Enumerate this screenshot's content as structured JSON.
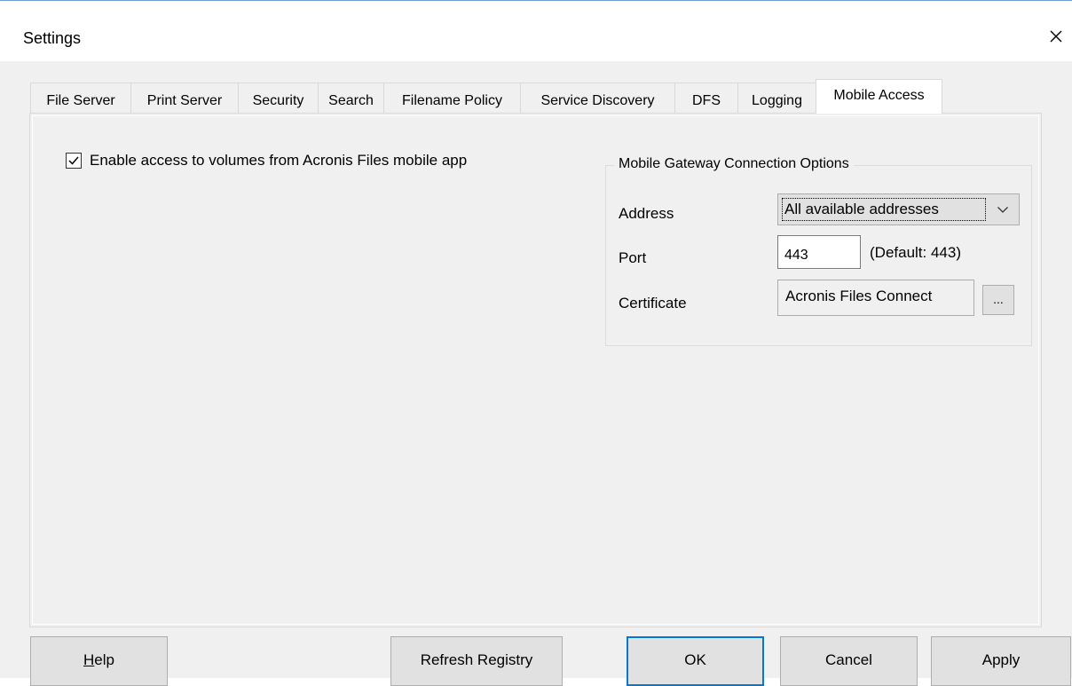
{
  "window": {
    "title": "Settings",
    "close_icon": "close-icon",
    "accent_color": "#0078d7"
  },
  "tabs": [
    {
      "label": "File Server",
      "active": false
    },
    {
      "label": "Print Server",
      "active": false
    },
    {
      "label": "Security",
      "active": false
    },
    {
      "label": "Search",
      "active": false
    },
    {
      "label": "Filename Policy",
      "active": false
    },
    {
      "label": "Service Discovery",
      "active": false
    },
    {
      "label": "DFS",
      "active": false
    },
    {
      "label": "Logging",
      "active": false
    },
    {
      "label": "Mobile Access",
      "active": true
    }
  ],
  "mobile_access": {
    "enable_checkbox": {
      "label": "Enable access to volumes from Acronis Files mobile app",
      "checked": true
    },
    "gateway_group": {
      "title": "Mobile Gateway Connection Options",
      "address_label": "Address",
      "address_value": "All available addresses",
      "port_label": "Port",
      "port_value": "443",
      "port_default": "(Default: 443)",
      "certificate_label": "Certificate",
      "certificate_value": "Acronis Files Connect",
      "certificate_browse": "..."
    }
  },
  "buttons": {
    "help_mnemonic": "H",
    "help_rest": "elp",
    "refresh_registry": "Refresh Registry",
    "ok": "OK",
    "cancel": "Cancel",
    "apply": "Apply"
  }
}
